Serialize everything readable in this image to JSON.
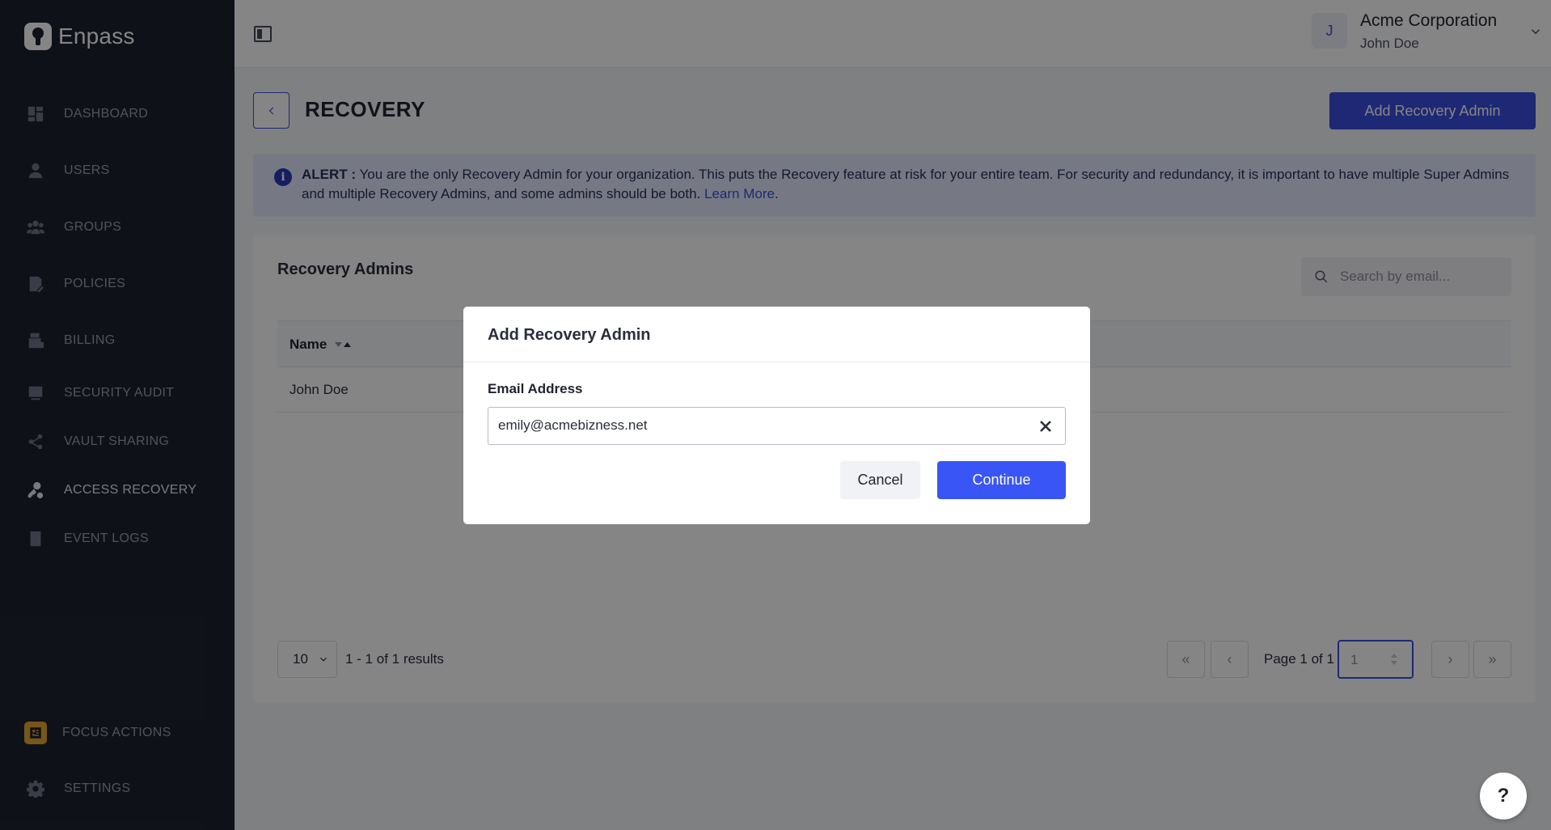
{
  "brand": {
    "name": "Enpass"
  },
  "sidebar": {
    "items": [
      {
        "label": "DASHBOARD",
        "icon": "dashboard-icon"
      },
      {
        "label": "USERS",
        "icon": "user-icon"
      },
      {
        "label": "GROUPS",
        "icon": "groups-icon"
      },
      {
        "label": "POLICIES",
        "icon": "policy-icon"
      },
      {
        "label": "BILLING",
        "icon": "billing-icon"
      },
      {
        "label": "SECURITY AUDIT",
        "icon": "audit-icon"
      },
      {
        "label": "VAULT SHARING",
        "icon": "share-icon"
      },
      {
        "label": "ACCESS RECOVERY",
        "icon": "key-person-icon",
        "active": true
      },
      {
        "label": "EVENT LOGS",
        "icon": "log-icon"
      }
    ],
    "focus_actions": "FOCUS ACTIONS",
    "settings": "SETTINGS"
  },
  "header": {
    "org_initial": "J",
    "org_name": "Acme Corporation",
    "user_name": "John Doe"
  },
  "page": {
    "title": "RECOVERY",
    "add_button": "Add Recovery Admin"
  },
  "alert": {
    "prefix": "ALERT :",
    "message": " You are the only Recovery Admin for your organization. This puts the Recovery feature at risk for your entire team. For security and redundancy, it is important to have multiple Super Admins and multiple Recovery Admins, and some admins should be both. ",
    "link": "Learn More",
    "suffix": "."
  },
  "card": {
    "title": "Recovery Admins",
    "search_placeholder": "Search by email...",
    "columns": [
      "Name"
    ],
    "rows": [
      {
        "name": "John Doe"
      }
    ],
    "page_size": "10",
    "results": "1 - 1 of 1 results",
    "page_of": "Page 1 of 1",
    "page_value": "1"
  },
  "modal": {
    "title": "Add Recovery Admin",
    "field_label": "Email Address",
    "email_value": "emily@acmebizness.net",
    "cancel": "Cancel",
    "continue": "Continue"
  },
  "help": {
    "label": "?"
  },
  "colors": {
    "accent": "#3a4ee0",
    "sidebar_bg": "#1e2230",
    "focus_badge": "#e3a72f"
  }
}
